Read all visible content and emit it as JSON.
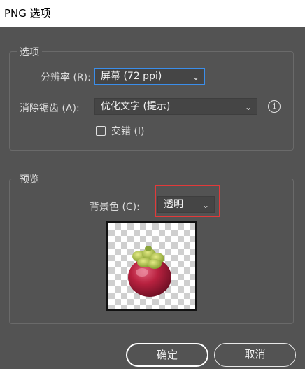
{
  "window": {
    "title": "PNG 选项"
  },
  "options_group": {
    "title": "选项",
    "resolution": {
      "label": "分辨率 (R):",
      "value": "屏幕 (72 ppi)"
    },
    "antialias": {
      "label": "消除锯齿 (A):",
      "value": "优化文字 (提示)"
    },
    "interlace": {
      "label": "交错 (I)",
      "checked": false
    }
  },
  "preview_group": {
    "title": "预览",
    "background": {
      "label": "背景色 (C):",
      "value": "透明"
    }
  },
  "buttons": {
    "ok": "确定",
    "cancel": "取消"
  },
  "colors": {
    "highlight": "#e23a3a",
    "focus": "#3b8eea",
    "dialog_bg": "#535353"
  }
}
